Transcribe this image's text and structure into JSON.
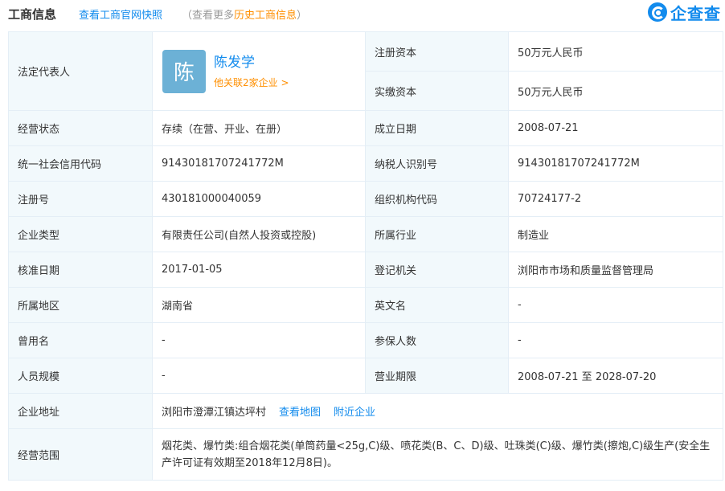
{
  "header": {
    "title": "工商信息",
    "snapshot_link": "查看工商官网快照",
    "history_prefix": "（查看更多",
    "history_link": "历史工商信息",
    "history_suffix": "）"
  },
  "logo": {
    "icon": "qichacha-logo-icon",
    "text": "企查查"
  },
  "legal_rep": {
    "label": "法定代表人",
    "avatar_char": "陈",
    "name": "陈发学",
    "related": "他关联2家企业 >"
  },
  "fields": {
    "registered_capital": {
      "label": "注册资本",
      "value": "50万元人民币"
    },
    "paid_capital": {
      "label": "实缴资本",
      "value": "50万元人民币"
    },
    "status": {
      "label": "经营状态",
      "value": "存续（在营、开业、在册）"
    },
    "established": {
      "label": "成立日期",
      "value": "2008-07-21"
    },
    "credit_code": {
      "label": "统一社会信用代码",
      "value": "91430181707241772M"
    },
    "taxpayer_id": {
      "label": "纳税人识别号",
      "value": "91430181707241772M"
    },
    "reg_number": {
      "label": "注册号",
      "value": "430181000040059"
    },
    "org_code": {
      "label": "组织机构代码",
      "value": "70724177-2"
    },
    "company_type": {
      "label": "企业类型",
      "value": "有限责任公司(自然人投资或控股)"
    },
    "industry": {
      "label": "所属行业",
      "value": "制造业"
    },
    "approval_date": {
      "label": "核准日期",
      "value": "2017-01-05"
    },
    "authority": {
      "label": "登记机关",
      "value": "浏阳市市场和质量监督管理局"
    },
    "region": {
      "label": "所属地区",
      "value": "湖南省"
    },
    "english_name": {
      "label": "英文名",
      "value": "-"
    },
    "former_name": {
      "label": "曾用名",
      "value": "-"
    },
    "insured": {
      "label": "参保人数",
      "value": "-"
    },
    "staff_size": {
      "label": "人员规模",
      "value": "-"
    },
    "business_term": {
      "label": "营业期限",
      "value": "2008-07-21 至 2028-07-20"
    },
    "address": {
      "label": "企业地址",
      "value": "浏阳市澄潭江镇达坪村",
      "map_link": "查看地图",
      "nearby_link": "附近企业"
    },
    "scope": {
      "label": "经营范围",
      "value": "烟花类、爆竹类:组合烟花类(单筒药量<25g,C)级、喷花类(B、C、D)级、吐珠类(C)级、爆竹类(擦炮,C)级生产(安全生产许可证有效期至2018年12月8日)。"
    }
  }
}
